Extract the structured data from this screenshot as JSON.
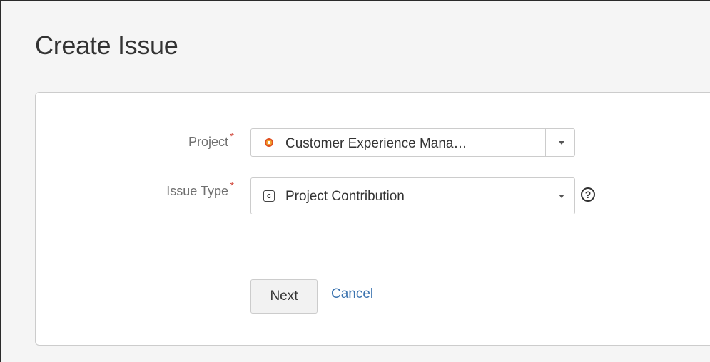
{
  "dialog": {
    "title": "Create Issue"
  },
  "form": {
    "project": {
      "label": "Project",
      "required_marker": "*",
      "value": "Customer Experience Mana…",
      "icon": "project-avatar-icon"
    },
    "issue_type": {
      "label": "Issue Type",
      "required_marker": "*",
      "value": "Project Contribution",
      "icon_glyph": "c",
      "icon": "issue-type-contribution-icon",
      "help_glyph": "?"
    }
  },
  "actions": {
    "next_label": "Next",
    "cancel_label": "Cancel"
  },
  "colors": {
    "required": "#d04437",
    "link": "#3b73af",
    "label": "#707070",
    "text": "#333333"
  }
}
